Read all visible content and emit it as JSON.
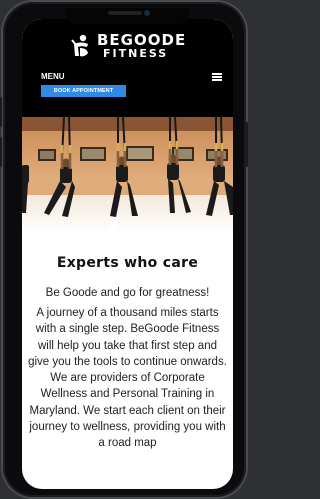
{
  "header": {
    "logo_title": "BEGOODE",
    "logo_subtitle": "FITNESS",
    "menu_label": "MENU",
    "book_button": "BOOK APPOINTMENT"
  },
  "hero": {
    "slides_total": 3,
    "active_slide": 1
  },
  "main": {
    "heading": "Experts who care",
    "tagline": "Be Goode and go for greatness!",
    "paragraph": "A journey of a thousand miles starts with a single step. BeGoode Fitness will help you take that first step and give you the tools to continue onwards. We are providers of Corporate Wellness and Personal Training in Maryland. We start each client on their journey to wellness, providing you with a road map"
  },
  "colors": {
    "header_bg": "#000000",
    "accent_blue": "#2f8be4",
    "body_text": "#222222"
  },
  "icons": [
    "logo-mark-icon",
    "hamburger-menu-icon"
  ]
}
